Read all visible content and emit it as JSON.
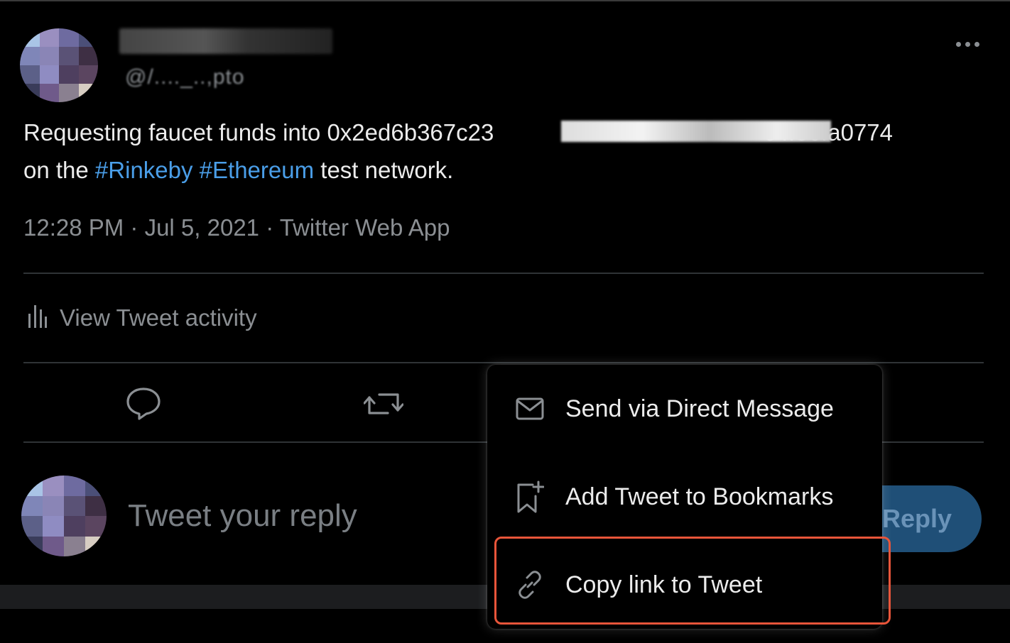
{
  "tweet": {
    "display_name": "",
    "handle": "@/...._..,pto",
    "text_prefix": "Requesting faucet funds into 0x2ed6b367c23",
    "text_suffix": "c4f36fa0774",
    "line2_prefix": "on the ",
    "hashtag1": "#Rinkeby",
    "hashtag2": "#Ethereum",
    "line2_suffix": " test network.",
    "meta": "12:28 PM · Jul 5, 2021 · Twitter Web App",
    "activity_label": "View Tweet activity"
  },
  "reply": {
    "placeholder": "Tweet your reply",
    "button_label": "Reply"
  },
  "share_menu": {
    "items": [
      {
        "label": "Send via Direct Message",
        "icon": "envelope-icon"
      },
      {
        "label": "Add Tweet to Bookmarks",
        "icon": "bookmark-add-icon"
      },
      {
        "label": "Copy link to Tweet",
        "icon": "link-icon"
      }
    ],
    "highlight_color": "#e8553a"
  },
  "colors": {
    "background": "#000000",
    "text": "#ececec",
    "muted": "#8b8f93",
    "hashtag": "#4a9ee8",
    "reply_button_bg": "#1f4f77"
  }
}
